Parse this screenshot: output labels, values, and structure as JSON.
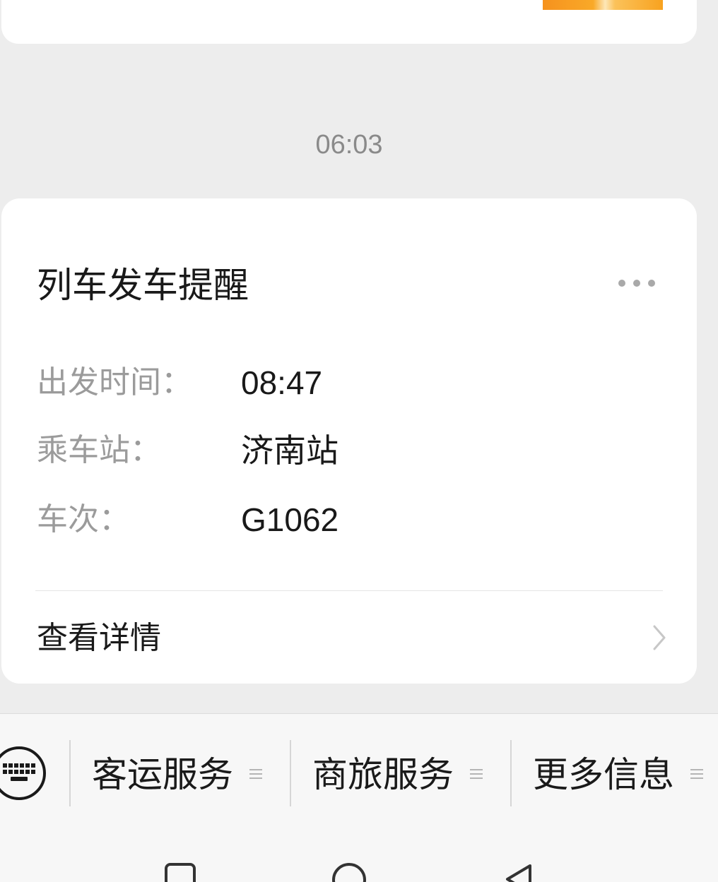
{
  "timestamp": "06:03",
  "card": {
    "title": "列车发车提醒",
    "rows": [
      {
        "label": "出发时间：",
        "value": "08:47"
      },
      {
        "label": "乘车站：",
        "value": "济南站"
      },
      {
        "label": "车次：",
        "value": "G1062"
      }
    ],
    "details_link": "查看详情"
  },
  "menu": [
    {
      "label": "客运服务",
      "icon": "menu-lines-icon"
    },
    {
      "label": "商旅服务",
      "icon": "menu-lines-icon"
    },
    {
      "label": "更多信息",
      "icon": "menu-lines-icon"
    }
  ],
  "icons": {
    "more": "more-dots-icon",
    "details": "chevron-right-icon",
    "keyboard": "keyboard-icon",
    "nav_recents": "square-recents-icon",
    "nav_home": "circle-home-icon",
    "nav_back": "triangle-back-icon"
  },
  "colors": {
    "background": "#ededed",
    "card": "#ffffff",
    "text_primary": "#191919",
    "text_secondary": "#9b9b9b",
    "timestamp": "#8a8a8a",
    "thumbnail_accent": "#f9a928"
  }
}
